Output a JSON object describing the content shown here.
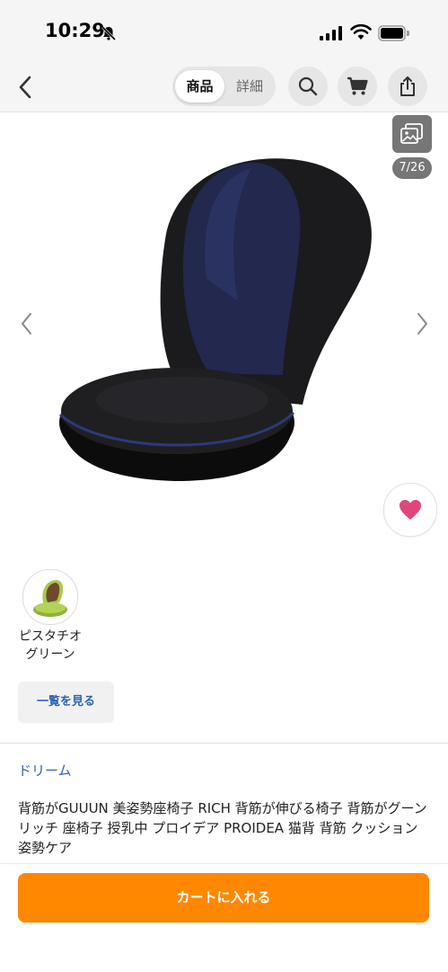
{
  "status_bar": {
    "time": "10:29"
  },
  "nav": {
    "tabs": [
      {
        "label": "商品",
        "active": true
      },
      {
        "label": "詳細",
        "active": false
      }
    ]
  },
  "gallery": {
    "counter": "7/26"
  },
  "variant": {
    "label": "ピスタチオ\nグリーン"
  },
  "see_all_label": "一覧を見る",
  "store_name": "ドリーム",
  "product_title": "背筋がGUUUN 美姿勢座椅子 RICH 背筋が伸びる椅子 背筋がグーン リッチ 座椅子 授乳中 プロイデア PROIDEA 猫背 背筋 クッション 姿勢ケア",
  "cart_button_label": "カートに入れる",
  "colors": {
    "accent": "#ff8800",
    "link": "#2c62b4",
    "heart": "#e0457b"
  }
}
